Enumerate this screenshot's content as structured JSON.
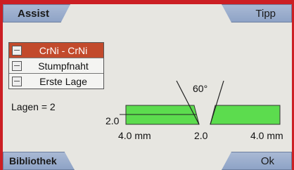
{
  "softkeys": {
    "top_left": "Assist",
    "top_right": "Tipp",
    "bottom_left": "Bibliothek",
    "bottom_right": "Ok"
  },
  "menu": {
    "items": [
      {
        "label": "CrNi - CrNi",
        "selected": true
      },
      {
        "label": "Stumpfnaht",
        "selected": false
      },
      {
        "label": "Erste Lage",
        "selected": false
      }
    ]
  },
  "lagen": "Lagen = 2",
  "diagram": {
    "angle": "60°",
    "thickness": "2.0",
    "left_width": "4.0 mm",
    "gap": "2.0",
    "right_width": "4.0 mm",
    "plate_color": "#5cdc4e"
  }
}
